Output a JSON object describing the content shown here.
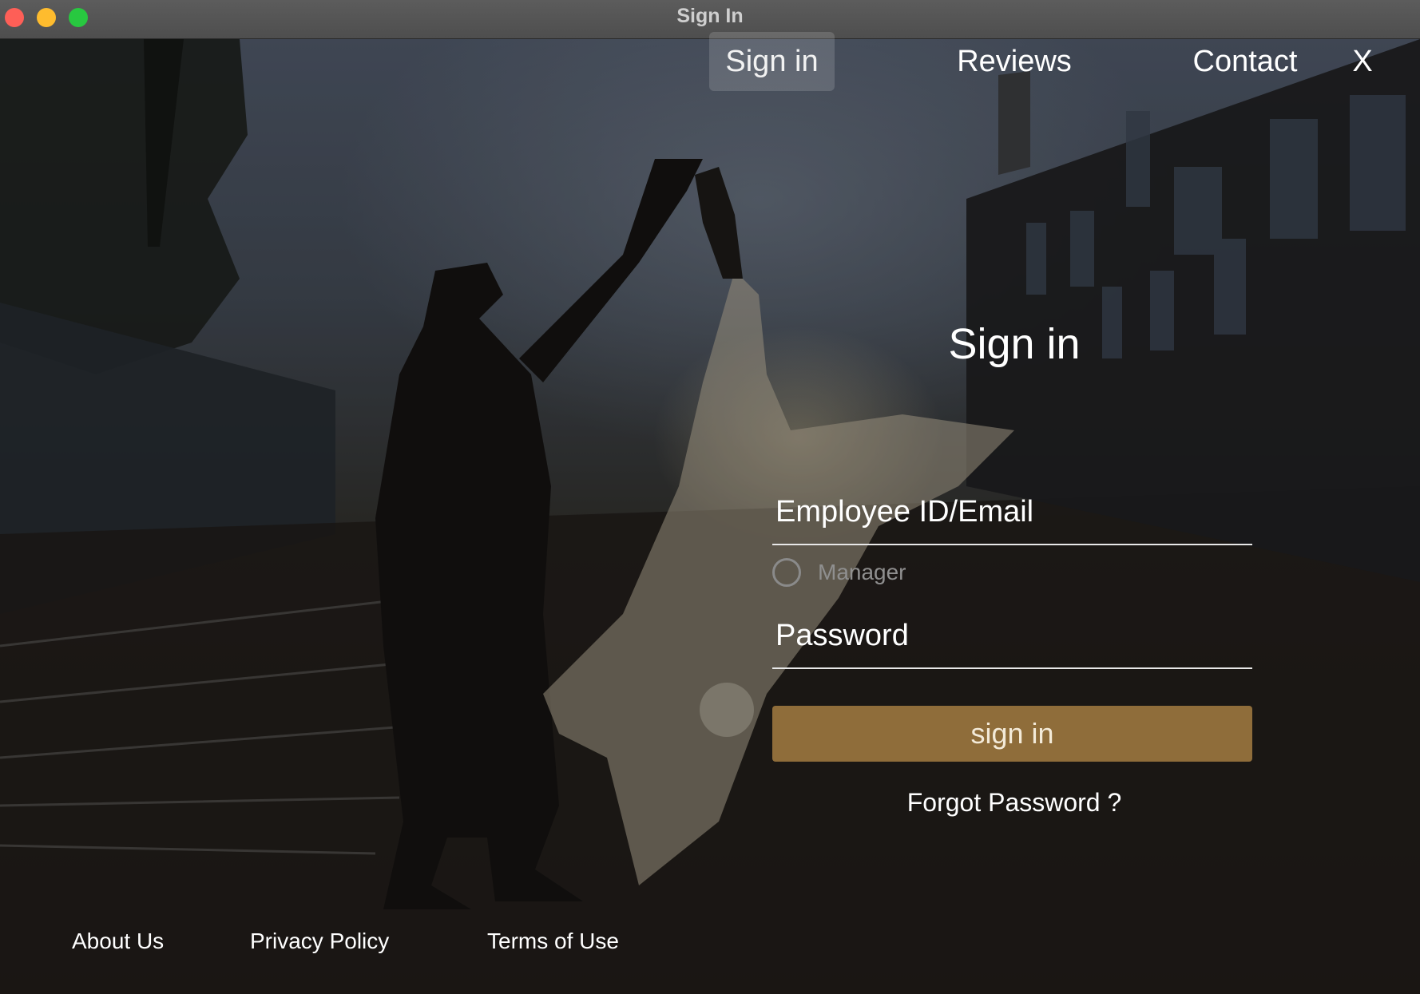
{
  "window": {
    "title": "Sign In"
  },
  "nav": {
    "items": [
      {
        "label": "Sign in",
        "active": true
      },
      {
        "label": "Reviews",
        "active": false
      },
      {
        "label": "Contact",
        "active": false
      }
    ],
    "close_label": "X"
  },
  "form": {
    "heading": "Sign in",
    "email_placeholder": "Employee ID/Email",
    "manager_label": "Manager",
    "manager_checked": false,
    "password_placeholder": "Password",
    "submit_label": "sign in",
    "forgot_label": "Forgot Password ?"
  },
  "footer": {
    "links": [
      "About Us",
      "Privacy Policy",
      "Terms of Use"
    ]
  },
  "colors": {
    "accent_button": "#8f6d3a",
    "title_bar": "#555555"
  }
}
